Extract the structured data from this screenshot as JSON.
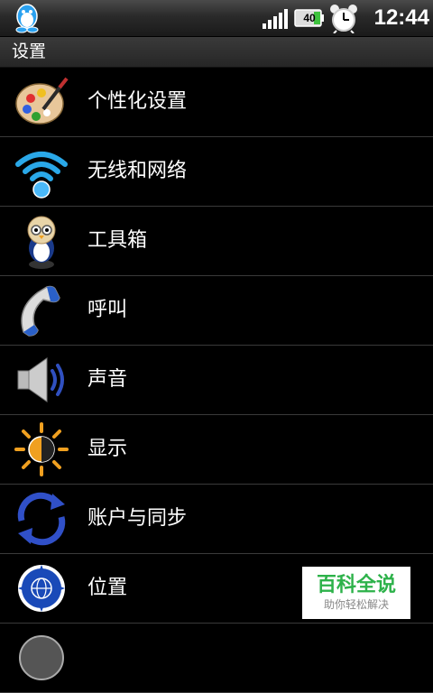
{
  "status_bar": {
    "app_icon": "qq-penguin-icon",
    "signal_icon": "signal-strength-icon",
    "battery_level": "40",
    "alarm_icon": "alarm-clock-icon",
    "time": "12:44"
  },
  "title": "设置",
  "items": [
    {
      "label": "个性化设置",
      "icon": "palette-icon"
    },
    {
      "label": "无线和网络",
      "icon": "wifi-icon"
    },
    {
      "label": "工具箱",
      "icon": "toolbox-mascot-icon"
    },
    {
      "label": "呼叫",
      "icon": "phone-handset-icon"
    },
    {
      "label": "声音",
      "icon": "speaker-icon"
    },
    {
      "label": "显示",
      "icon": "brightness-icon"
    },
    {
      "label": "账户与同步",
      "icon": "sync-icon"
    },
    {
      "label": "位置",
      "icon": "globe-location-icon"
    },
    {
      "label": "",
      "icon": "partial-item-icon"
    }
  ],
  "watermark": {
    "title": "百科全说",
    "subtitle": "助你轻松解决"
  },
  "colors": {
    "background": "#000000",
    "divider": "#3a3a3a",
    "text": "#ffffff",
    "watermark_green": "#2db24a"
  }
}
